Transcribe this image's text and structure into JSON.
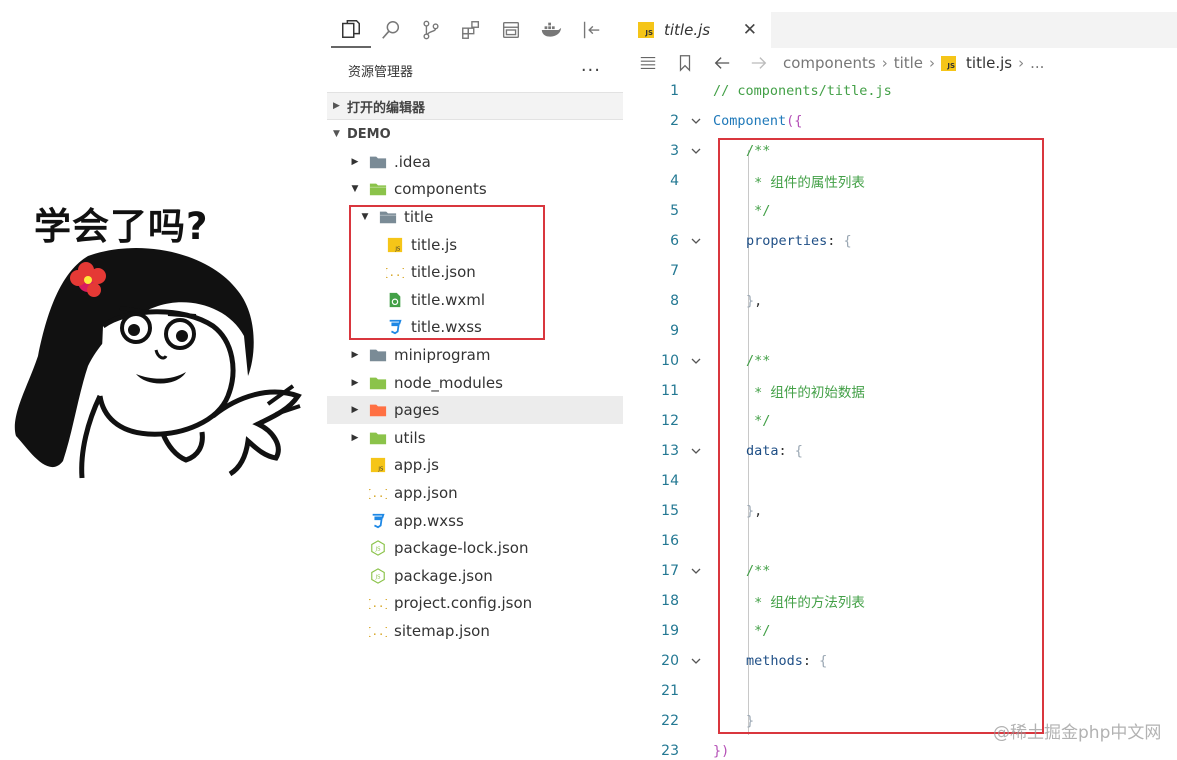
{
  "meme": {
    "caption": "学会了吗?"
  },
  "activity_bar": {
    "icons": [
      "files-icon",
      "search-icon",
      "source-control-icon",
      "extensions-icon",
      "remote-explorer-icon",
      "docker-icon",
      "collapse-sidebar-icon"
    ]
  },
  "explorer": {
    "title": "资源管理器",
    "more": "···",
    "open_editors_label": "打开的编辑器",
    "workspace_label": "DEMO",
    "items": [
      {
        "label": ".idea",
        "kind": "folder",
        "depth": 1,
        "expanded": false,
        "color": "#7a8b96"
      },
      {
        "label": "components",
        "kind": "folder",
        "depth": 1,
        "expanded": true,
        "color": "#8bc34a"
      },
      {
        "label": "title",
        "kind": "folder",
        "depth": 2,
        "expanded": true,
        "color": "#7a8b96"
      },
      {
        "label": "title.js",
        "kind": "js",
        "depth": 3
      },
      {
        "label": "title.json",
        "kind": "json",
        "depth": 3
      },
      {
        "label": "title.wxml",
        "kind": "wxml",
        "depth": 3
      },
      {
        "label": "title.wxss",
        "kind": "css",
        "depth": 3
      },
      {
        "label": "miniprogram",
        "kind": "folder",
        "depth": 1,
        "expanded": false,
        "color": "#7a8b96"
      },
      {
        "label": "node_modules",
        "kind": "folder",
        "depth": 1,
        "expanded": false,
        "color": "#8bc34a"
      },
      {
        "label": "pages",
        "kind": "folder",
        "depth": 1,
        "expanded": false,
        "color": "#ff7043",
        "highlighted": true
      },
      {
        "label": "utils",
        "kind": "folder",
        "depth": 1,
        "expanded": false,
        "color": "#8bc34a"
      },
      {
        "label": "app.js",
        "kind": "js",
        "depth": 1
      },
      {
        "label": "app.json",
        "kind": "json",
        "depth": 1
      },
      {
        "label": "app.wxss",
        "kind": "css",
        "depth": 1
      },
      {
        "label": "package-lock.json",
        "kind": "node",
        "depth": 1
      },
      {
        "label": "package.json",
        "kind": "node",
        "depth": 1
      },
      {
        "label": "project.config.json",
        "kind": "json",
        "depth": 1
      },
      {
        "label": "sitemap.json",
        "kind": "json",
        "depth": 1
      }
    ]
  },
  "editor": {
    "tab": {
      "title": "title.js",
      "close": "✕",
      "badge": "JS"
    },
    "breadcrumb": {
      "parts": [
        "components",
        "title"
      ],
      "file": "title.js",
      "trail": "..."
    },
    "lines": [
      {
        "n": "1",
        "fold": false,
        "indent": 0,
        "tokens": [
          [
            "// components/title.js",
            "c-comment"
          ]
        ]
      },
      {
        "n": "2",
        "fold": true,
        "indent": 0,
        "tokens": [
          [
            "Component",
            "c-fn"
          ],
          [
            "({",
            "c-paren"
          ]
        ]
      },
      {
        "n": "3",
        "fold": true,
        "indent": 1,
        "tokens": [
          [
            "/**",
            "c-comment"
          ]
        ]
      },
      {
        "n": "4",
        "fold": false,
        "indent": 1,
        "tokens": [
          [
            " * 组件的属性列表",
            "c-comment"
          ]
        ]
      },
      {
        "n": "5",
        "fold": false,
        "indent": 1,
        "tokens": [
          [
            " */",
            "c-comment"
          ]
        ]
      },
      {
        "n": "6",
        "fold": true,
        "indent": 1,
        "tokens": [
          [
            "properties",
            "c-prop"
          ],
          [
            ": ",
            "c-punct"
          ],
          [
            "{",
            "c-brace"
          ]
        ]
      },
      {
        "n": "7",
        "fold": false,
        "indent": 1,
        "tokens": []
      },
      {
        "n": "8",
        "fold": false,
        "indent": 1,
        "tokens": [
          [
            "}",
            "c-brace"
          ],
          [
            ",",
            "c-punct"
          ]
        ]
      },
      {
        "n": "9",
        "fold": false,
        "indent": 1,
        "tokens": []
      },
      {
        "n": "10",
        "fold": true,
        "indent": 1,
        "tokens": [
          [
            "/**",
            "c-comment"
          ]
        ]
      },
      {
        "n": "11",
        "fold": false,
        "indent": 1,
        "tokens": [
          [
            " * 组件的初始数据",
            "c-comment"
          ]
        ]
      },
      {
        "n": "12",
        "fold": false,
        "indent": 1,
        "tokens": [
          [
            " */",
            "c-comment"
          ]
        ]
      },
      {
        "n": "13",
        "fold": true,
        "indent": 1,
        "tokens": [
          [
            "data",
            "c-prop"
          ],
          [
            ": ",
            "c-punct"
          ],
          [
            "{",
            "c-brace"
          ]
        ]
      },
      {
        "n": "14",
        "fold": false,
        "indent": 1,
        "tokens": []
      },
      {
        "n": "15",
        "fold": false,
        "indent": 1,
        "tokens": [
          [
            "}",
            "c-brace"
          ],
          [
            ",",
            "c-punct"
          ]
        ]
      },
      {
        "n": "16",
        "fold": false,
        "indent": 1,
        "tokens": []
      },
      {
        "n": "17",
        "fold": true,
        "indent": 1,
        "tokens": [
          [
            "/**",
            "c-comment"
          ]
        ]
      },
      {
        "n": "18",
        "fold": false,
        "indent": 1,
        "tokens": [
          [
            " * 组件的方法列表",
            "c-comment"
          ]
        ]
      },
      {
        "n": "19",
        "fold": false,
        "indent": 1,
        "tokens": [
          [
            " */",
            "c-comment"
          ]
        ]
      },
      {
        "n": "20",
        "fold": true,
        "indent": 1,
        "tokens": [
          [
            "methods",
            "c-prop"
          ],
          [
            ": ",
            "c-punct"
          ],
          [
            "{",
            "c-brace"
          ]
        ]
      },
      {
        "n": "21",
        "fold": false,
        "indent": 1,
        "tokens": []
      },
      {
        "n": "22",
        "fold": false,
        "indent": 1,
        "tokens": [
          [
            "}",
            "c-brace"
          ]
        ]
      },
      {
        "n": "23",
        "fold": false,
        "indent": 0,
        "tokens": [
          [
            "})",
            "c-paren"
          ]
        ]
      }
    ]
  },
  "watermark": "@稀土掘金php中文网",
  "colors": {
    "highlight_border": "#d9363e",
    "comment": "#43a047",
    "keyword": "#1e78b9"
  }
}
